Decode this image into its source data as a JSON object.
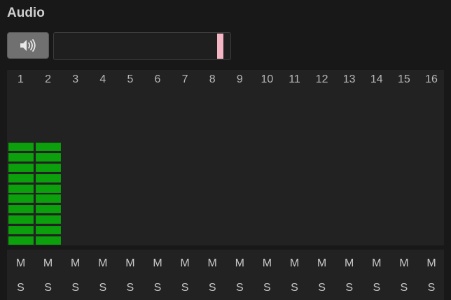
{
  "header": {
    "title": "Audio"
  },
  "mute_button": {
    "icon": "speaker-icon"
  },
  "volume": {
    "level": 0.96,
    "handle_color": "#f4b6c4"
  },
  "channels": [
    {
      "label": "1",
      "level": 0.667,
      "mute": "M",
      "solo": "S"
    },
    {
      "label": "2",
      "level": 0.667,
      "mute": "M",
      "solo": "S"
    },
    {
      "label": "3",
      "level": 0,
      "mute": "M",
      "solo": "S"
    },
    {
      "label": "4",
      "level": 0,
      "mute": "M",
      "solo": "S"
    },
    {
      "label": "5",
      "level": 0,
      "mute": "M",
      "solo": "S"
    },
    {
      "label": "6",
      "level": 0,
      "mute": "M",
      "solo": "S"
    },
    {
      "label": "7",
      "level": 0,
      "mute": "M",
      "solo": "S"
    },
    {
      "label": "8",
      "level": 0,
      "mute": "M",
      "solo": "S"
    },
    {
      "label": "9",
      "level": 0,
      "mute": "M",
      "solo": "S"
    },
    {
      "label": "10",
      "level": 0,
      "mute": "M",
      "solo": "S"
    },
    {
      "label": "11",
      "level": 0,
      "mute": "M",
      "solo": "S"
    },
    {
      "label": "12",
      "level": 0,
      "mute": "M",
      "solo": "S"
    },
    {
      "label": "13",
      "level": 0,
      "mute": "M",
      "solo": "S"
    },
    {
      "label": "14",
      "level": 0,
      "mute": "M",
      "solo": "S"
    },
    {
      "label": "15",
      "level": 0,
      "mute": "M",
      "solo": "S"
    },
    {
      "label": "16",
      "level": 0,
      "mute": "M",
      "solo": "S"
    }
  ],
  "meter_colors": {
    "active": "#0ca00c"
  }
}
